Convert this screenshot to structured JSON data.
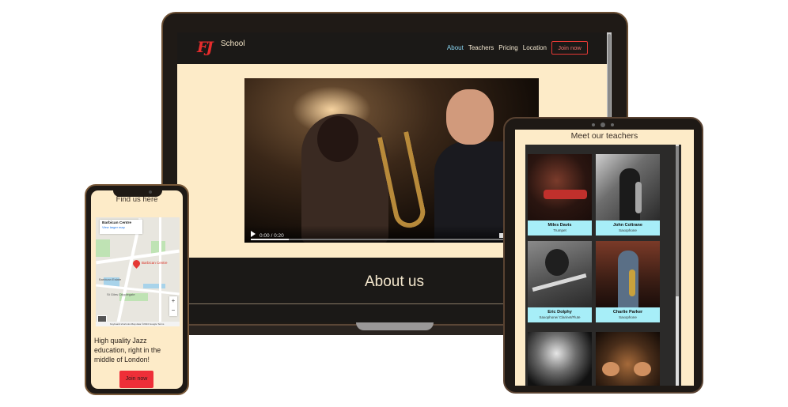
{
  "laptop": {
    "logo_mark": "FJ",
    "logo_text": "School",
    "nav": [
      "About",
      "Teachers",
      "Pricing",
      "Location"
    ],
    "active_nav": "About",
    "join_label": "Join now",
    "video": {
      "time": "0:00 / 0:20",
      "progress": 0.15
    },
    "about_heading": "About us"
  },
  "tablet": {
    "heading": "Meet our teachers",
    "teachers": [
      {
        "name": "Miles Davis",
        "instrument": "Trumpet"
      },
      {
        "name": "John Coltrane",
        "instrument": "Saxophone"
      },
      {
        "name": "Eric Dolphy",
        "instrument": "Saxophone/ Clarinet/Flute"
      },
      {
        "name": "Charlie Parker",
        "instrument": "Saxophone"
      }
    ]
  },
  "phone": {
    "heading": "Find us here",
    "map": {
      "place_title": "Barbican Centre",
      "place_link": "View larger map",
      "pin_label": "Barbican Centre",
      "labels": [
        "Barbican Estate",
        "St Giles Cripplegate"
      ],
      "footer": "Keyboard shortcuts  Map data ©2024 Google  Terms"
    },
    "tagline": "High quality Jazz education, right in the middle of London!",
    "join_label": "Join now"
  },
  "colors": {
    "accent_red": "#e53935",
    "cream": "#fdebc8",
    "dark": "#1b1917",
    "caption_cyan": "#a7eef8",
    "nav_active": "#8ad6f2"
  }
}
